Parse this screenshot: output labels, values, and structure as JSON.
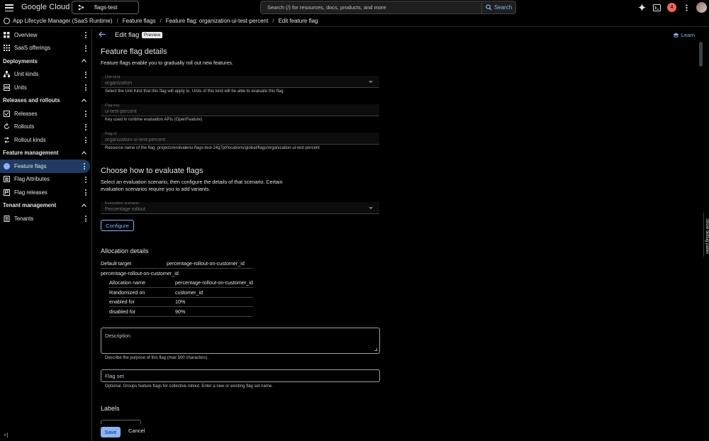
{
  "header": {
    "brand": "Google Cloud",
    "project": "flags-test",
    "search_placeholder": "Search (/) for resources, docs, products, and more",
    "search_button": "Search",
    "notification_count": "4"
  },
  "breadcrumb": [
    "App Lifecycle Manager (SaaS Runtime)",
    "Feature flags",
    "Feature flag: organization-ui-test-percent",
    "Edit feature flag"
  ],
  "sidebar": {
    "items_top": [
      {
        "label": "Overview",
        "icon": "grid-icon"
      },
      {
        "label": "SaaS offerings",
        "icon": "apps-icon"
      }
    ],
    "sections": [
      {
        "title": "Deployments",
        "items": [
          {
            "label": "Unit kinds",
            "icon": "hierarchy-icon"
          },
          {
            "label": "Units",
            "icon": "units-icon"
          }
        ]
      },
      {
        "title": "Releases and rollouts",
        "items": [
          {
            "label": "Releases",
            "icon": "release-icon"
          },
          {
            "label": "Rollouts",
            "icon": "rollout-icon"
          },
          {
            "label": "Rollout kinds",
            "icon": "rollout-kinds-icon"
          }
        ]
      },
      {
        "title": "Feature management",
        "items": [
          {
            "label": "Feature flags",
            "icon": "flag-icon",
            "active": true
          },
          {
            "label": "Flag Attributes",
            "icon": "list-icon"
          },
          {
            "label": "Flag releases",
            "icon": "flag-release-icon"
          }
        ]
      },
      {
        "title": "Tenant management",
        "items": [
          {
            "label": "Tenants",
            "icon": "tenant-icon"
          }
        ]
      }
    ],
    "collapse_label": "<|"
  },
  "page": {
    "title": "Edit flag",
    "badge": "Preview",
    "learn": "Learn"
  },
  "details": {
    "heading": "Feature flag details",
    "intro": "Feature flags enable you to gradually roll out new features.",
    "unit_kind": {
      "label": "Unit kind",
      "value": "organization",
      "hint": "Select the Unit Kind that this flag will apply to. Units of this kind will be able to evaluate this flag."
    },
    "flag_key": {
      "label": "Flag key",
      "value": "ui-test-percent",
      "hint": "Key used in runtime evaluation APIs (OpenFeature)"
    },
    "flag_id": {
      "label": "Flag id",
      "value": "organization-ui-test-percent",
      "hint": "Resource name of the flag: projects/erolvaleriu-flags-test-24g7pt/locations/global/flags/organization-ui-test-percent"
    }
  },
  "evaluate": {
    "heading": "Choose how to evaluate flags",
    "text1": "Select an evaluation scenario, then configure the details of that scenario. Certain",
    "text2": "evaluation scenarios require you to add variants.",
    "scenario": {
      "label": "Evaluation scenario",
      "value": "Percentage rollout"
    },
    "configure": "Configure"
  },
  "allocation": {
    "heading": "Allocation details",
    "default_target_label": "Default target",
    "default_target_value": "percentage-rollout-on-customer_id",
    "group_title": "percentage-rollout-on-customer_id",
    "rows": [
      {
        "k": "Allocation name",
        "v": "percentage-rollout-on-customer_id"
      },
      {
        "k": "Randomized on",
        "v": "customer_id"
      },
      {
        "k": "enabled for",
        "v": "10%"
      },
      {
        "k": "disabled for",
        "v": "90%"
      }
    ]
  },
  "description": {
    "placeholder": "Description",
    "hint": "Describe the purpose of this flag (max 500 characters)."
  },
  "flag_set": {
    "placeholder": "Flag set",
    "hint": "Optional. Groups feature flags for collective rollout. Enter a new or existing flag set name."
  },
  "labels_heading": "Labels",
  "actions": {
    "save": "Save",
    "cancel": "Cancel"
  },
  "debug_panel": "Show debug panel"
}
